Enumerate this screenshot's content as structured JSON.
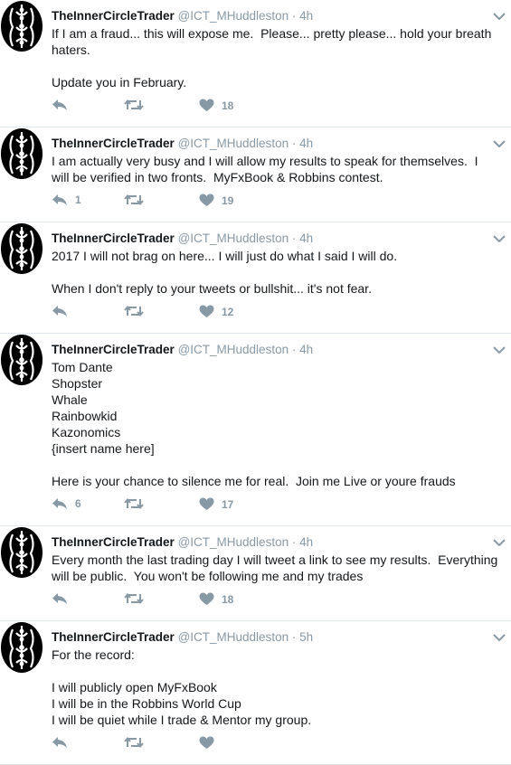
{
  "account": {
    "name": "TheInnerCircleTrader",
    "handle": "@ICT_MHuddleston"
  },
  "icons": {
    "avatar": "ict-logo-icon",
    "caret": "chevron-down-icon",
    "reply": "reply-icon",
    "retweet": "retweet-icon",
    "like": "heart-icon"
  },
  "colors": {
    "muted": "#8899a6",
    "text": "#14171a",
    "border": "#e1e8ed"
  },
  "tweets": [
    {
      "time": "4h",
      "text": "If I am a fraud... this will expose me.  Please... pretty please... hold your breath haters.\n\nUpdate you in February.",
      "replies": "",
      "retweets": "",
      "likes": "18"
    },
    {
      "time": "4h",
      "text": "I am actually very busy and I will allow my results to speak for themselves.  I will be verified in two fronts.  MyFxBook & Robbins contest.",
      "replies": "1",
      "retweets": "",
      "likes": "19"
    },
    {
      "time": "4h",
      "text": "2017 I will not brag on here... I will just do what I said I will do.\n\nWhen I don't reply to your tweets or bullshit... it's not fear.",
      "replies": "",
      "retweets": "",
      "likes": "12"
    },
    {
      "time": "4h",
      "text": "Tom Dante\nShopster\nWhale\nRainbowkid\nKazonomics\n{insert name here]\n\nHere is your chance to silence me for real.  Join me Live or youre frauds",
      "replies": "6",
      "retweets": "",
      "likes": "17"
    },
    {
      "time": "4h",
      "text": "Every month the last trading day I will tweet a link to see my results.  Everything will be public.  You won't be following me and my trades",
      "replies": "",
      "retweets": "",
      "likes": "18"
    },
    {
      "time": "5h",
      "text": "For the record:\n\nI will publicly open MyFxBook\nI will be in the Robbins World Cup\nI will be quiet while I trade & Mentor my group.",
      "replies": "",
      "retweets": "",
      "likes": ""
    }
  ]
}
